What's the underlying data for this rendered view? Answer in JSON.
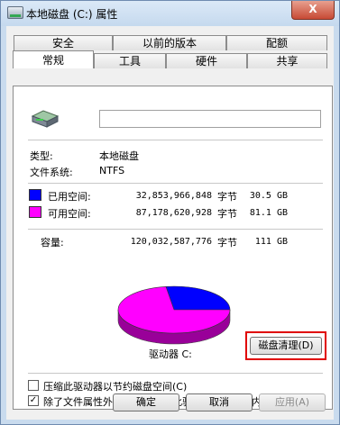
{
  "window": {
    "title": "本地磁盘 (C:) 属性",
    "close_label": "X"
  },
  "tabs_row1": [
    {
      "label": "安全"
    },
    {
      "label": "以前的版本"
    },
    {
      "label": "配额"
    }
  ],
  "tabs_row2": [
    {
      "label": "常规"
    },
    {
      "label": "工具"
    },
    {
      "label": "硬件"
    },
    {
      "label": "共享"
    }
  ],
  "active_tab": "常规",
  "general": {
    "drive_name_value": "",
    "type_label": "类型:",
    "type_value": "本地磁盘",
    "fs_label": "文件系统:",
    "fs_value": "NTFS",
    "used_label": "已用空间:",
    "used_bytes": "32,853,966,848",
    "used_unit": "字节",
    "used_gb": "30.5 GB",
    "free_label": "可用空间:",
    "free_bytes": "87,178,620,928",
    "free_unit": "字节",
    "free_gb": "81.1 GB",
    "capacity_label": "容量:",
    "capacity_bytes": "120,032,587,776",
    "capacity_unit": "字节",
    "capacity_gb": "111 GB",
    "drive_caption": "驱动器 C:",
    "cleanup_button": "磁盘清理(D)",
    "compress_label": "压缩此驱动器以节约磁盘空间(C)",
    "compress_checked": false,
    "index_label": "除了文件属性外，还允许索引此驱动器上文件的内容(I)",
    "index_checked": true,
    "used_color": "#0000ff",
    "free_color": "#ff00ff"
  },
  "buttons": {
    "ok": "确定",
    "cancel": "取消",
    "apply": "应用(A)"
  },
  "chart_data": {
    "type": "pie",
    "categories": [
      "已用空间",
      "可用空间"
    ],
    "values": [
      30.5,
      81.1
    ],
    "colors": [
      "#0000ff",
      "#ff00ff"
    ]
  }
}
